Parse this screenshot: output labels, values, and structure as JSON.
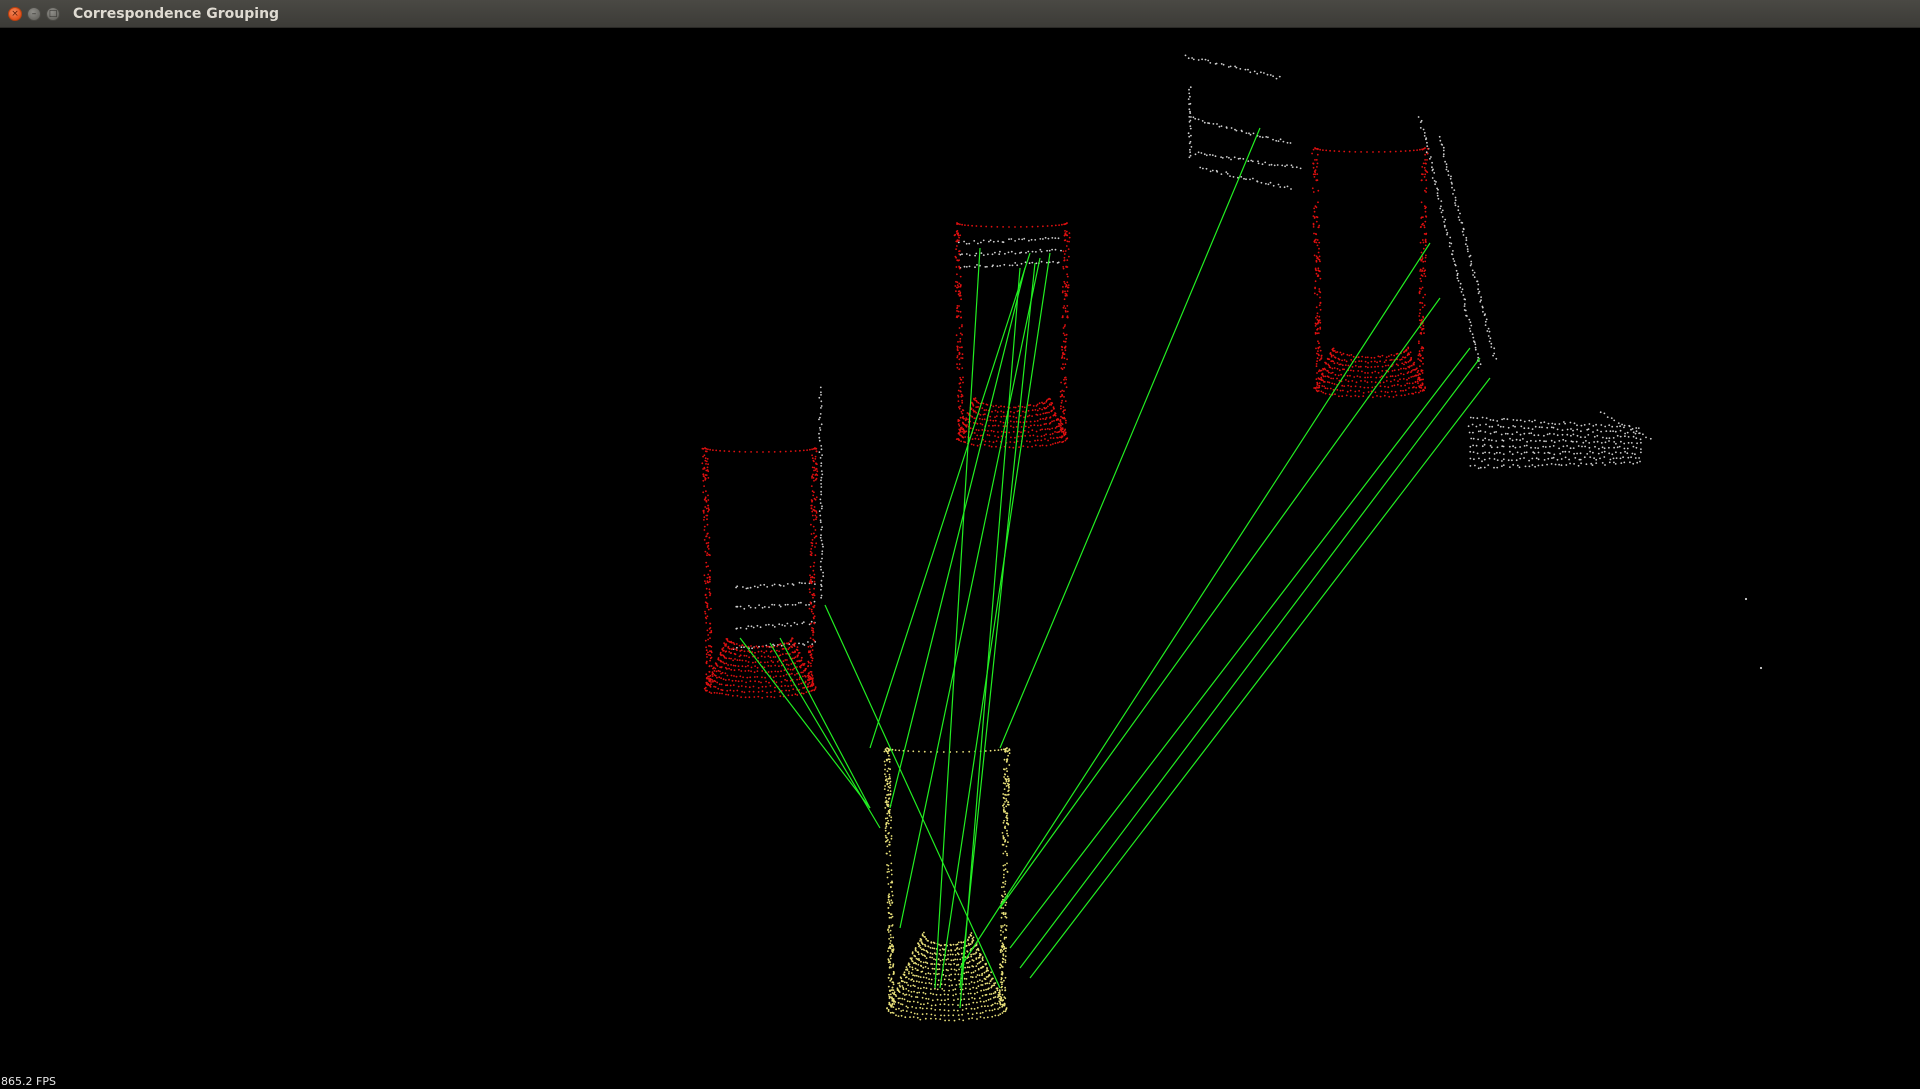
{
  "window": {
    "title": "Correspondence Grouping",
    "close_glyph": "×",
    "minimize_glyph": "–",
    "maximize_glyph": "□"
  },
  "viewer": {
    "background": "#000000",
    "fps_text": "865.2 FPS",
    "colors": {
      "scene_cloud": "#cfcfcf",
      "recognized_instances": "#e01010",
      "model_cloud": "#e8e07a",
      "correspondence_lines": "#22ee22"
    }
  }
}
